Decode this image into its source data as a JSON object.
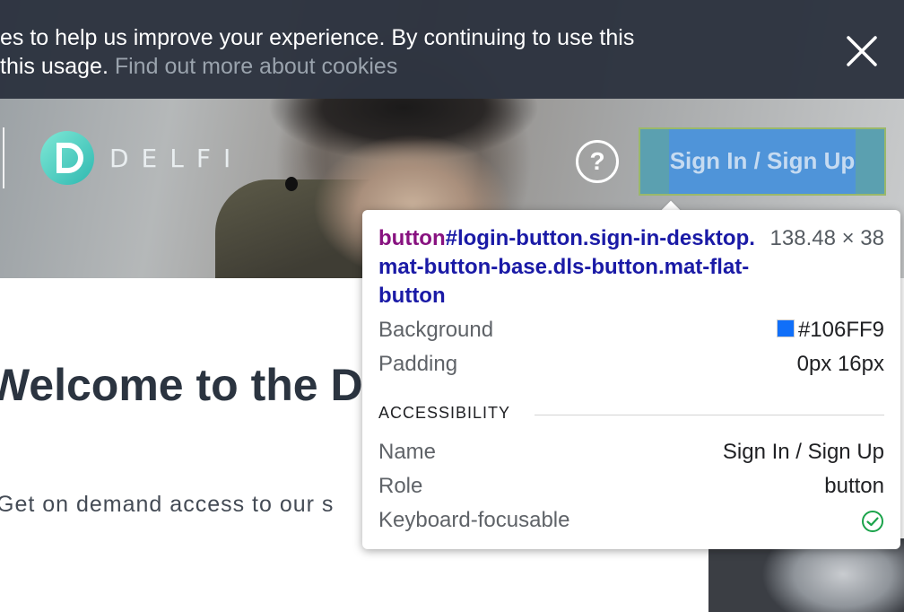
{
  "cookie_banner": {
    "line1": "es to help us improve your experience. By continuing to use this",
    "line2_prefix": "this usage. ",
    "link": "Find out more about cookies"
  },
  "header": {
    "logo_text": "DELFI",
    "help_icon": "question-circle-icon",
    "help_glyph": "?",
    "login_label": "Sign In / Sign Up"
  },
  "main": {
    "title": "Welcome to the D",
    "subtitle": "Get on demand access to our s"
  },
  "inspector": {
    "tag": "button",
    "selector": "#login-button.sign-in-desktop.mat-button-base.dls-button.mat-flat-button",
    "size": "138.48 × 38",
    "rows": [
      {
        "label": "Background",
        "value": "#106FF9"
      },
      {
        "label": "Padding",
        "value": "0px 16px"
      }
    ],
    "section": "ACCESSIBILITY",
    "a11y": [
      {
        "label": "Name",
        "value": "Sign In / Sign Up"
      },
      {
        "label": "Role",
        "value": "button"
      },
      {
        "label": "Keyboard-focusable",
        "value": ""
      }
    ],
    "swatch_color": "#106FF9"
  },
  "colors": {
    "banner_bg": "#2c323e",
    "link": "#9aa3ad",
    "logo_teal": "#48d6c6",
    "login_bg": "#4f94d9",
    "selector_tag": "#881280",
    "selector_rest": "#1a1aa6",
    "check_green": "#1aa34a"
  }
}
